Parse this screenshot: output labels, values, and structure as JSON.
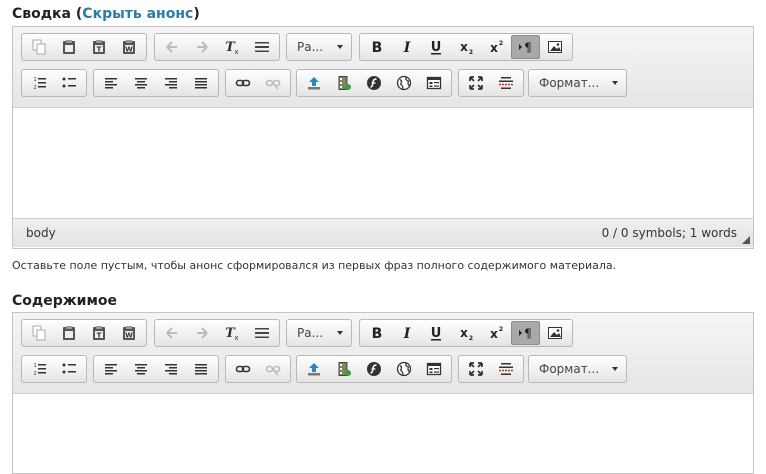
{
  "summary": {
    "label": "Сводка",
    "paren_open": " (",
    "toggle_link": "Скрыть анонс",
    "paren_close": ")",
    "status_path": "body",
    "status_count": "0 / 0 symbols; 1 words",
    "hint": "Оставьте поле пустым, чтобы анонс сформировался из первых фраз полного содержимого материала."
  },
  "content": {
    "label": "Содержимое"
  },
  "toolbar": {
    "font_dropdown": "Ра...",
    "format_dropdown": "Формат...",
    "icons_row1": [
      "copy-icon",
      "paste-icon",
      "paste-text-icon",
      "paste-word-icon",
      "undo-icon",
      "redo-icon",
      "remove-format-icon",
      "horizontal-rule-icon",
      "bold-icon",
      "italic-icon",
      "underline-icon",
      "subscript-icon",
      "superscript-icon",
      "show-blocks-icon",
      "image-icon"
    ],
    "icons_row2": [
      "numbered-list-icon",
      "bulleted-list-icon",
      "align-left-icon",
      "align-center-icon",
      "align-right-icon",
      "align-justify-icon",
      "link-icon",
      "unlink-icon",
      "upload-icon",
      "media-icon",
      "flash-icon",
      "globe-icon",
      "template-icon",
      "maximize-icon",
      "strikethrough-lines-icon"
    ]
  },
  "colors": {
    "link": "#2a7ca6",
    "active_button": "#a9a9a9"
  }
}
